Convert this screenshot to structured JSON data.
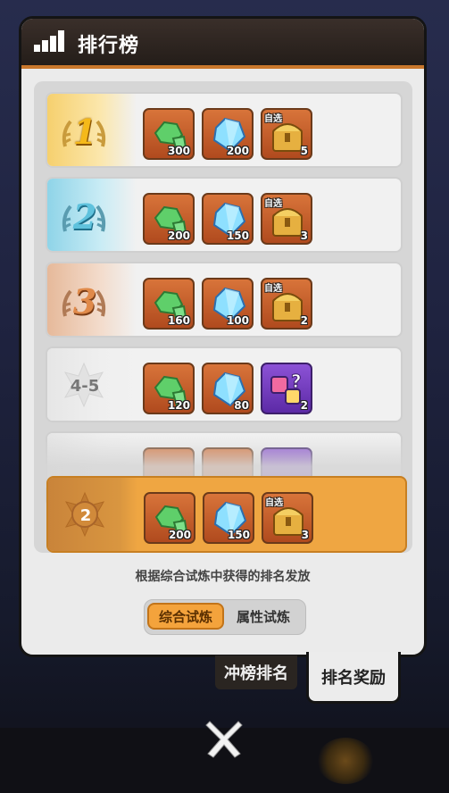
{
  "header": {
    "title": "排行榜"
  },
  "rows": [
    {
      "rank": "1",
      "items": [
        {
          "icon": "green-ore-icon",
          "qty": "300"
        },
        {
          "icon": "blue-diamond-icon",
          "qty": "200"
        },
        {
          "icon": "gold-chest-icon",
          "tag": "自选",
          "qty": "5"
        }
      ]
    },
    {
      "rank": "2",
      "items": [
        {
          "icon": "green-ore-icon",
          "qty": "200"
        },
        {
          "icon": "blue-diamond-icon",
          "qty": "150"
        },
        {
          "icon": "gold-chest-icon",
          "tag": "自选",
          "qty": "3"
        }
      ]
    },
    {
      "rank": "3",
      "items": [
        {
          "icon": "green-ore-icon",
          "qty": "160"
        },
        {
          "icon": "blue-diamond-icon",
          "qty": "100"
        },
        {
          "icon": "gold-chest-icon",
          "tag": "自选",
          "qty": "2"
        }
      ]
    },
    {
      "rank": "4-5",
      "items": [
        {
          "icon": "green-ore-icon",
          "qty": "120"
        },
        {
          "icon": "blue-diamond-icon",
          "qty": "80"
        },
        {
          "icon": "purple-dice-icon",
          "qty": "2"
        }
      ]
    }
  ],
  "my_rank": {
    "rank": "2",
    "items": [
      {
        "icon": "green-ore-icon",
        "qty": "200"
      },
      {
        "icon": "blue-diamond-icon",
        "qty": "150"
      },
      {
        "icon": "gold-chest-icon",
        "tag": "自选",
        "qty": "3"
      }
    ]
  },
  "note": "根据综合试炼中获得的排名发放",
  "toggle": {
    "on": "综合试炼",
    "off": "属性试炼"
  },
  "tabs": {
    "ranking": "冲榜排名",
    "rewards": "排名奖励"
  },
  "colors": {
    "accent": "#f4a33c",
    "header": "#2c2420"
  }
}
